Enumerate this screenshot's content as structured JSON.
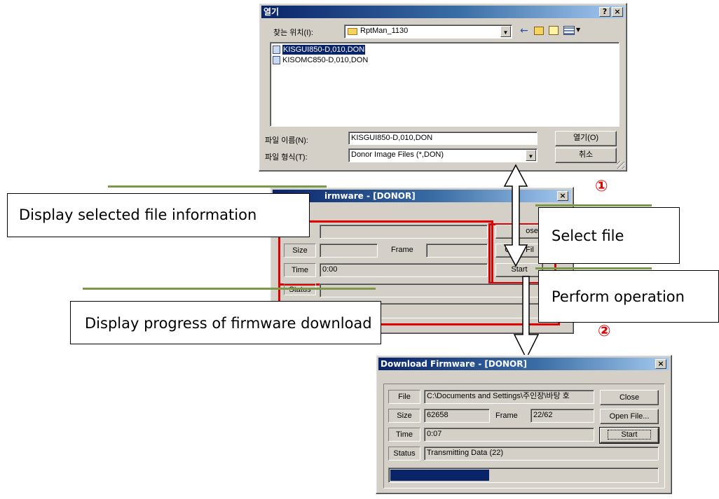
{
  "open_dialog": {
    "title": "열기",
    "help_btn": "?",
    "close_btn": "×",
    "look_in_label": "찾는 위치(I):",
    "look_in_value": "RptMan_1130",
    "files": [
      "KISGUI850-D,010,DON",
      "KISOMC850-D,010,DON"
    ],
    "filename_label": "파일 이름(N):",
    "filename_value": "KISGUI850-D,010,DON",
    "filetype_label": "파일 형식(T):",
    "filetype_value": "Donor Image Files (*,DON)",
    "open_btn": "열기(O)",
    "cancel_btn": "취소"
  },
  "mid_dialog": {
    "title_fragment": "irmware - [DONOR]",
    "close_x": "×",
    "size_label": "Size",
    "frame_label": "Frame",
    "time_label": "Time",
    "time_value": "0:00",
    "status_label": "Status",
    "close_btn_fragment": "ose",
    "open_file_fragment": "Open Fil",
    "start_fragment": "Start"
  },
  "download_dialog": {
    "title": "Download Firmware - [DONOR]",
    "close_x": "×",
    "file_label": "File",
    "file_value": "C:\\Documents and Settings\\주인장\\바탕 호",
    "size_label": "Size",
    "size_value": "62658",
    "frame_label": "Frame",
    "frame_value": "22/62",
    "time_label": "Time",
    "time_value": "0:07",
    "status_label": "Status",
    "status_value": "Transmitting Data (22)",
    "close_btn": "Close",
    "open_file_btn": "Open File...",
    "start_btn": "Start",
    "progress": 0.37
  },
  "callouts": {
    "display_file": "Display selected file information",
    "select_file": "Select file",
    "perform_op": "Perform operation",
    "display_progress": "Display progress of firmware download"
  },
  "markers": {
    "one": "①",
    "two": "②"
  },
  "colors": {
    "accent_red": "#e00000",
    "callout_green": "#7a9a4a",
    "titlebar": "#0a246a",
    "progress": "#0a246a"
  },
  "icons": [
    "folder-icon",
    "back-arrow-icon",
    "up-folder-icon",
    "new-folder-icon",
    "view-menu-icon",
    "file-icon"
  ]
}
